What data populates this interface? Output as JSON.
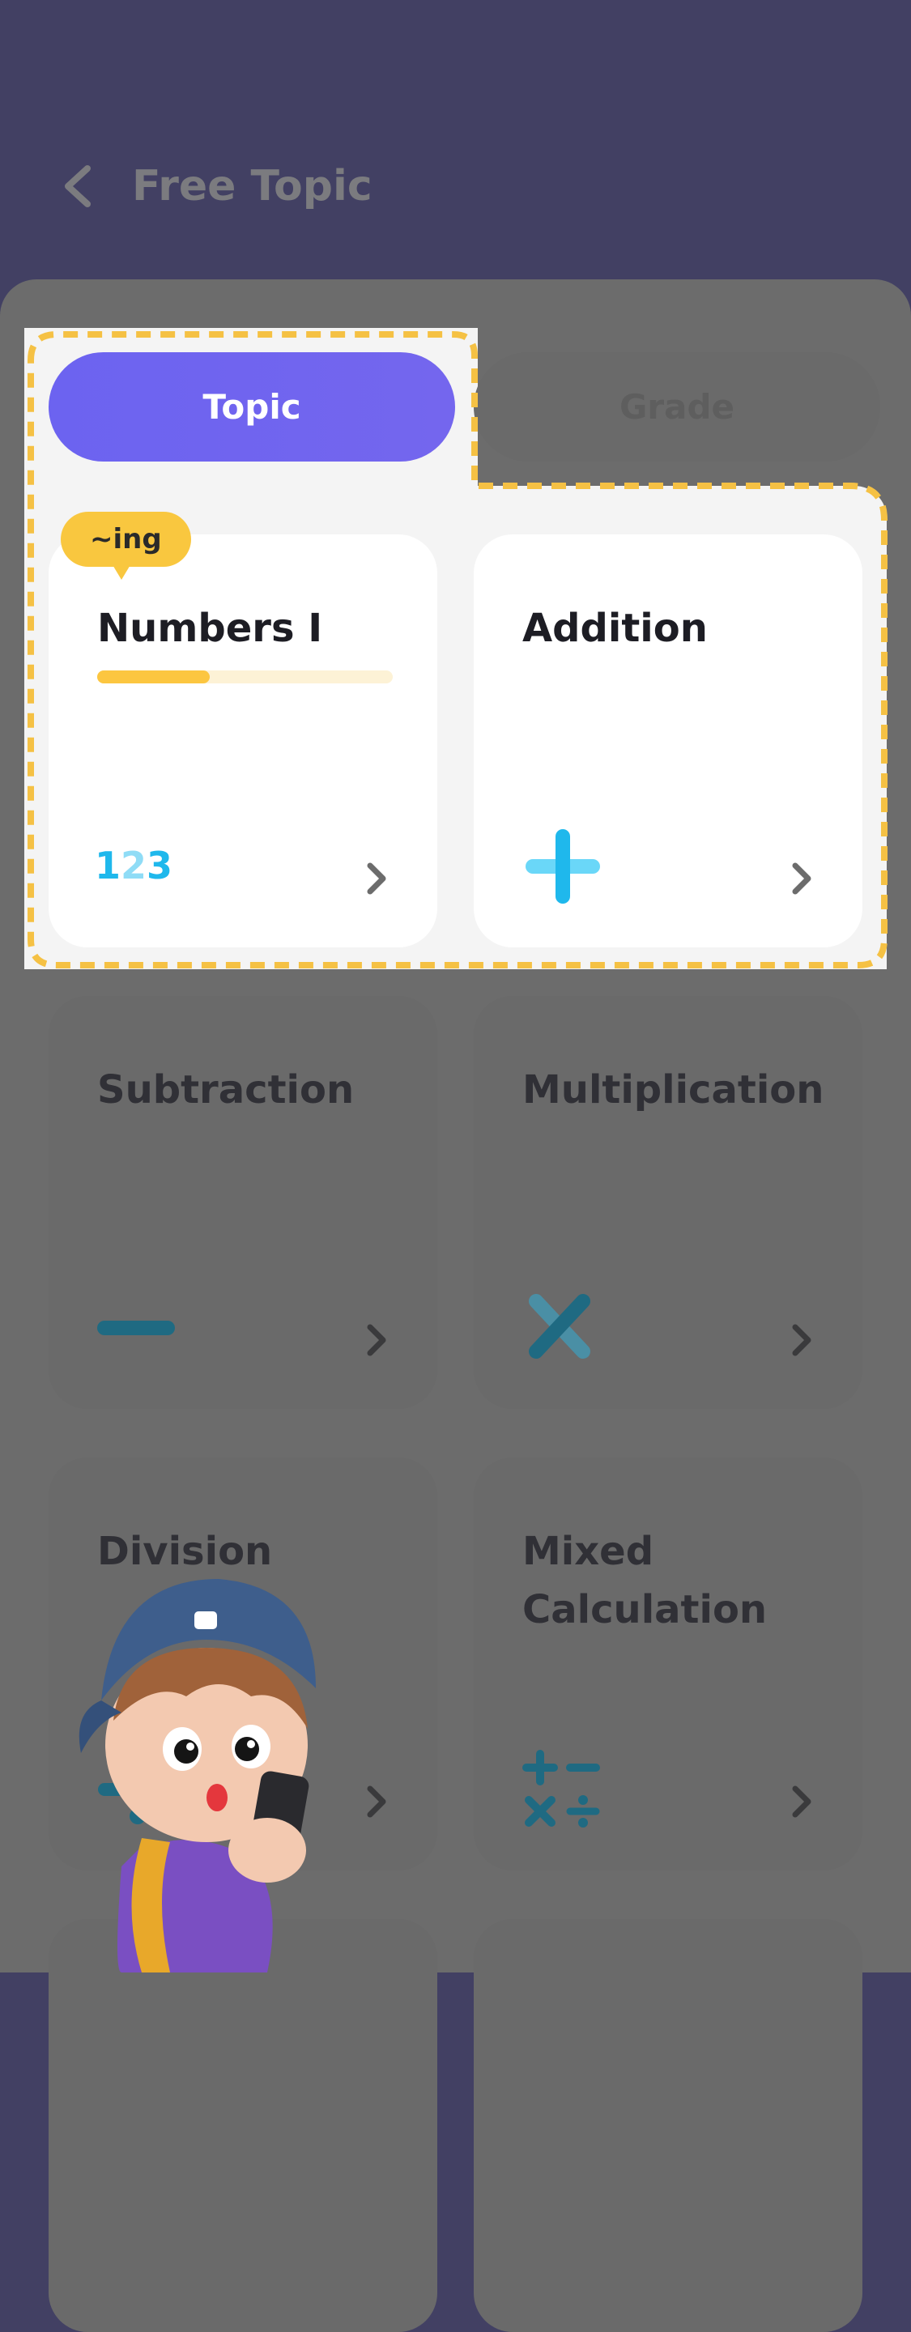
{
  "header": {
    "title": "Free Topic",
    "back_icon": "chevron-left-icon"
  },
  "tabs": [
    {
      "label": "Topic",
      "selected": true
    },
    {
      "label": "Grade",
      "selected": false
    }
  ],
  "topics": [
    {
      "title": "Numbers I",
      "badge": "~ing",
      "progress": 0.38,
      "icon": "numbers-123-icon",
      "highlighted": true
    },
    {
      "title": "Addition",
      "icon": "plus-icon",
      "highlighted": true
    },
    {
      "title": "Subtraction",
      "icon": "minus-icon",
      "highlighted": false
    },
    {
      "title": "Multiplication",
      "icon": "multiply-icon",
      "highlighted": false
    },
    {
      "title": "Division",
      "icon": "divide-icon",
      "highlighted": false
    },
    {
      "title": "Mixed Calculation",
      "icon": "mixed-operations-icon",
      "highlighted": false
    }
  ],
  "numbers_icon_text": {
    "d1": "1",
    "d2": "2",
    "d3": "3"
  },
  "colors": {
    "header_bg": "#424063",
    "tab_active": "#6c63f0",
    "badge": "#f9c73f",
    "progress": "#fcc640",
    "icon_blue": "#1fb8ec",
    "highlight_border": "#f5c144",
    "overlay": "#6c6c6c"
  }
}
